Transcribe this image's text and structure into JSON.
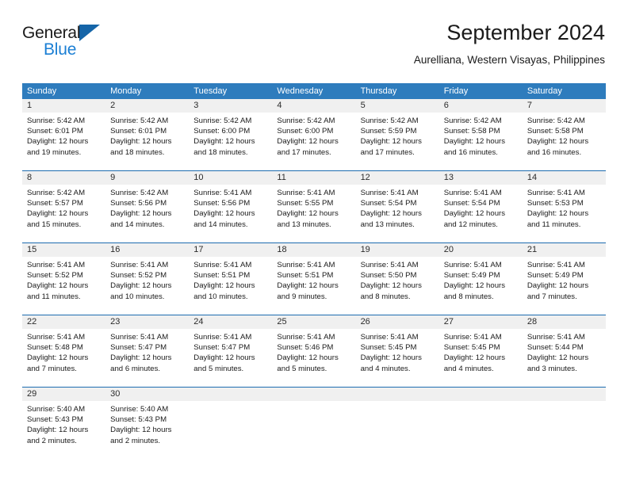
{
  "brand": {
    "line1": "General",
    "line2": "Blue",
    "triangle_color": "#1565a8",
    "blue_text_color": "#1b7fd4"
  },
  "header": {
    "title": "September 2024",
    "subtitle": "Aurelliana, Western Visayas, Philippines"
  },
  "theme": {
    "header_blue": "#2e7cbd",
    "row_rule_blue": "#1d6cb0",
    "day_band_gray": "#f0f0f0"
  },
  "weekdays": [
    "Sunday",
    "Monday",
    "Tuesday",
    "Wednesday",
    "Thursday",
    "Friday",
    "Saturday"
  ],
  "weeks": [
    {
      "days": [
        {
          "num": "1",
          "sunrise": "Sunrise: 5:42 AM",
          "sunset": "Sunset: 6:01 PM",
          "daylight1": "Daylight: 12 hours",
          "daylight2": "and 19 minutes."
        },
        {
          "num": "2",
          "sunrise": "Sunrise: 5:42 AM",
          "sunset": "Sunset: 6:01 PM",
          "daylight1": "Daylight: 12 hours",
          "daylight2": "and 18 minutes."
        },
        {
          "num": "3",
          "sunrise": "Sunrise: 5:42 AM",
          "sunset": "Sunset: 6:00 PM",
          "daylight1": "Daylight: 12 hours",
          "daylight2": "and 18 minutes."
        },
        {
          "num": "4",
          "sunrise": "Sunrise: 5:42 AM",
          "sunset": "Sunset: 6:00 PM",
          "daylight1": "Daylight: 12 hours",
          "daylight2": "and 17 minutes."
        },
        {
          "num": "5",
          "sunrise": "Sunrise: 5:42 AM",
          "sunset": "Sunset: 5:59 PM",
          "daylight1": "Daylight: 12 hours",
          "daylight2": "and 17 minutes."
        },
        {
          "num": "6",
          "sunrise": "Sunrise: 5:42 AM",
          "sunset": "Sunset: 5:58 PM",
          "daylight1": "Daylight: 12 hours",
          "daylight2": "and 16 minutes."
        },
        {
          "num": "7",
          "sunrise": "Sunrise: 5:42 AM",
          "sunset": "Sunset: 5:58 PM",
          "daylight1": "Daylight: 12 hours",
          "daylight2": "and 16 minutes."
        }
      ]
    },
    {
      "days": [
        {
          "num": "8",
          "sunrise": "Sunrise: 5:42 AM",
          "sunset": "Sunset: 5:57 PM",
          "daylight1": "Daylight: 12 hours",
          "daylight2": "and 15 minutes."
        },
        {
          "num": "9",
          "sunrise": "Sunrise: 5:42 AM",
          "sunset": "Sunset: 5:56 PM",
          "daylight1": "Daylight: 12 hours",
          "daylight2": "and 14 minutes."
        },
        {
          "num": "10",
          "sunrise": "Sunrise: 5:41 AM",
          "sunset": "Sunset: 5:56 PM",
          "daylight1": "Daylight: 12 hours",
          "daylight2": "and 14 minutes."
        },
        {
          "num": "11",
          "sunrise": "Sunrise: 5:41 AM",
          "sunset": "Sunset: 5:55 PM",
          "daylight1": "Daylight: 12 hours",
          "daylight2": "and 13 minutes."
        },
        {
          "num": "12",
          "sunrise": "Sunrise: 5:41 AM",
          "sunset": "Sunset: 5:54 PM",
          "daylight1": "Daylight: 12 hours",
          "daylight2": "and 13 minutes."
        },
        {
          "num": "13",
          "sunrise": "Sunrise: 5:41 AM",
          "sunset": "Sunset: 5:54 PM",
          "daylight1": "Daylight: 12 hours",
          "daylight2": "and 12 minutes."
        },
        {
          "num": "14",
          "sunrise": "Sunrise: 5:41 AM",
          "sunset": "Sunset: 5:53 PM",
          "daylight1": "Daylight: 12 hours",
          "daylight2": "and 11 minutes."
        }
      ]
    },
    {
      "days": [
        {
          "num": "15",
          "sunrise": "Sunrise: 5:41 AM",
          "sunset": "Sunset: 5:52 PM",
          "daylight1": "Daylight: 12 hours",
          "daylight2": "and 11 minutes."
        },
        {
          "num": "16",
          "sunrise": "Sunrise: 5:41 AM",
          "sunset": "Sunset: 5:52 PM",
          "daylight1": "Daylight: 12 hours",
          "daylight2": "and 10 minutes."
        },
        {
          "num": "17",
          "sunrise": "Sunrise: 5:41 AM",
          "sunset": "Sunset: 5:51 PM",
          "daylight1": "Daylight: 12 hours",
          "daylight2": "and 10 minutes."
        },
        {
          "num": "18",
          "sunrise": "Sunrise: 5:41 AM",
          "sunset": "Sunset: 5:51 PM",
          "daylight1": "Daylight: 12 hours",
          "daylight2": "and 9 minutes."
        },
        {
          "num": "19",
          "sunrise": "Sunrise: 5:41 AM",
          "sunset": "Sunset: 5:50 PM",
          "daylight1": "Daylight: 12 hours",
          "daylight2": "and 8 minutes."
        },
        {
          "num": "20",
          "sunrise": "Sunrise: 5:41 AM",
          "sunset": "Sunset: 5:49 PM",
          "daylight1": "Daylight: 12 hours",
          "daylight2": "and 8 minutes."
        },
        {
          "num": "21",
          "sunrise": "Sunrise: 5:41 AM",
          "sunset": "Sunset: 5:49 PM",
          "daylight1": "Daylight: 12 hours",
          "daylight2": "and 7 minutes."
        }
      ]
    },
    {
      "days": [
        {
          "num": "22",
          "sunrise": "Sunrise: 5:41 AM",
          "sunset": "Sunset: 5:48 PM",
          "daylight1": "Daylight: 12 hours",
          "daylight2": "and 7 minutes."
        },
        {
          "num": "23",
          "sunrise": "Sunrise: 5:41 AM",
          "sunset": "Sunset: 5:47 PM",
          "daylight1": "Daylight: 12 hours",
          "daylight2": "and 6 minutes."
        },
        {
          "num": "24",
          "sunrise": "Sunrise: 5:41 AM",
          "sunset": "Sunset: 5:47 PM",
          "daylight1": "Daylight: 12 hours",
          "daylight2": "and 5 minutes."
        },
        {
          "num": "25",
          "sunrise": "Sunrise: 5:41 AM",
          "sunset": "Sunset: 5:46 PM",
          "daylight1": "Daylight: 12 hours",
          "daylight2": "and 5 minutes."
        },
        {
          "num": "26",
          "sunrise": "Sunrise: 5:41 AM",
          "sunset": "Sunset: 5:45 PM",
          "daylight1": "Daylight: 12 hours",
          "daylight2": "and 4 minutes."
        },
        {
          "num": "27",
          "sunrise": "Sunrise: 5:41 AM",
          "sunset": "Sunset: 5:45 PM",
          "daylight1": "Daylight: 12 hours",
          "daylight2": "and 4 minutes."
        },
        {
          "num": "28",
          "sunrise": "Sunrise: 5:41 AM",
          "sunset": "Sunset: 5:44 PM",
          "daylight1": "Daylight: 12 hours",
          "daylight2": "and 3 minutes."
        }
      ]
    },
    {
      "days": [
        {
          "num": "29",
          "sunrise": "Sunrise: 5:40 AM",
          "sunset": "Sunset: 5:43 PM",
          "daylight1": "Daylight: 12 hours",
          "daylight2": "and 2 minutes."
        },
        {
          "num": "30",
          "sunrise": "Sunrise: 5:40 AM",
          "sunset": "Sunset: 5:43 PM",
          "daylight1": "Daylight: 12 hours",
          "daylight2": "and 2 minutes."
        },
        {
          "num": "",
          "sunrise": "",
          "sunset": "",
          "daylight1": "",
          "daylight2": ""
        },
        {
          "num": "",
          "sunrise": "",
          "sunset": "",
          "daylight1": "",
          "daylight2": ""
        },
        {
          "num": "",
          "sunrise": "",
          "sunset": "",
          "daylight1": "",
          "daylight2": ""
        },
        {
          "num": "",
          "sunrise": "",
          "sunset": "",
          "daylight1": "",
          "daylight2": ""
        },
        {
          "num": "",
          "sunrise": "",
          "sunset": "",
          "daylight1": "",
          "daylight2": ""
        }
      ]
    }
  ]
}
